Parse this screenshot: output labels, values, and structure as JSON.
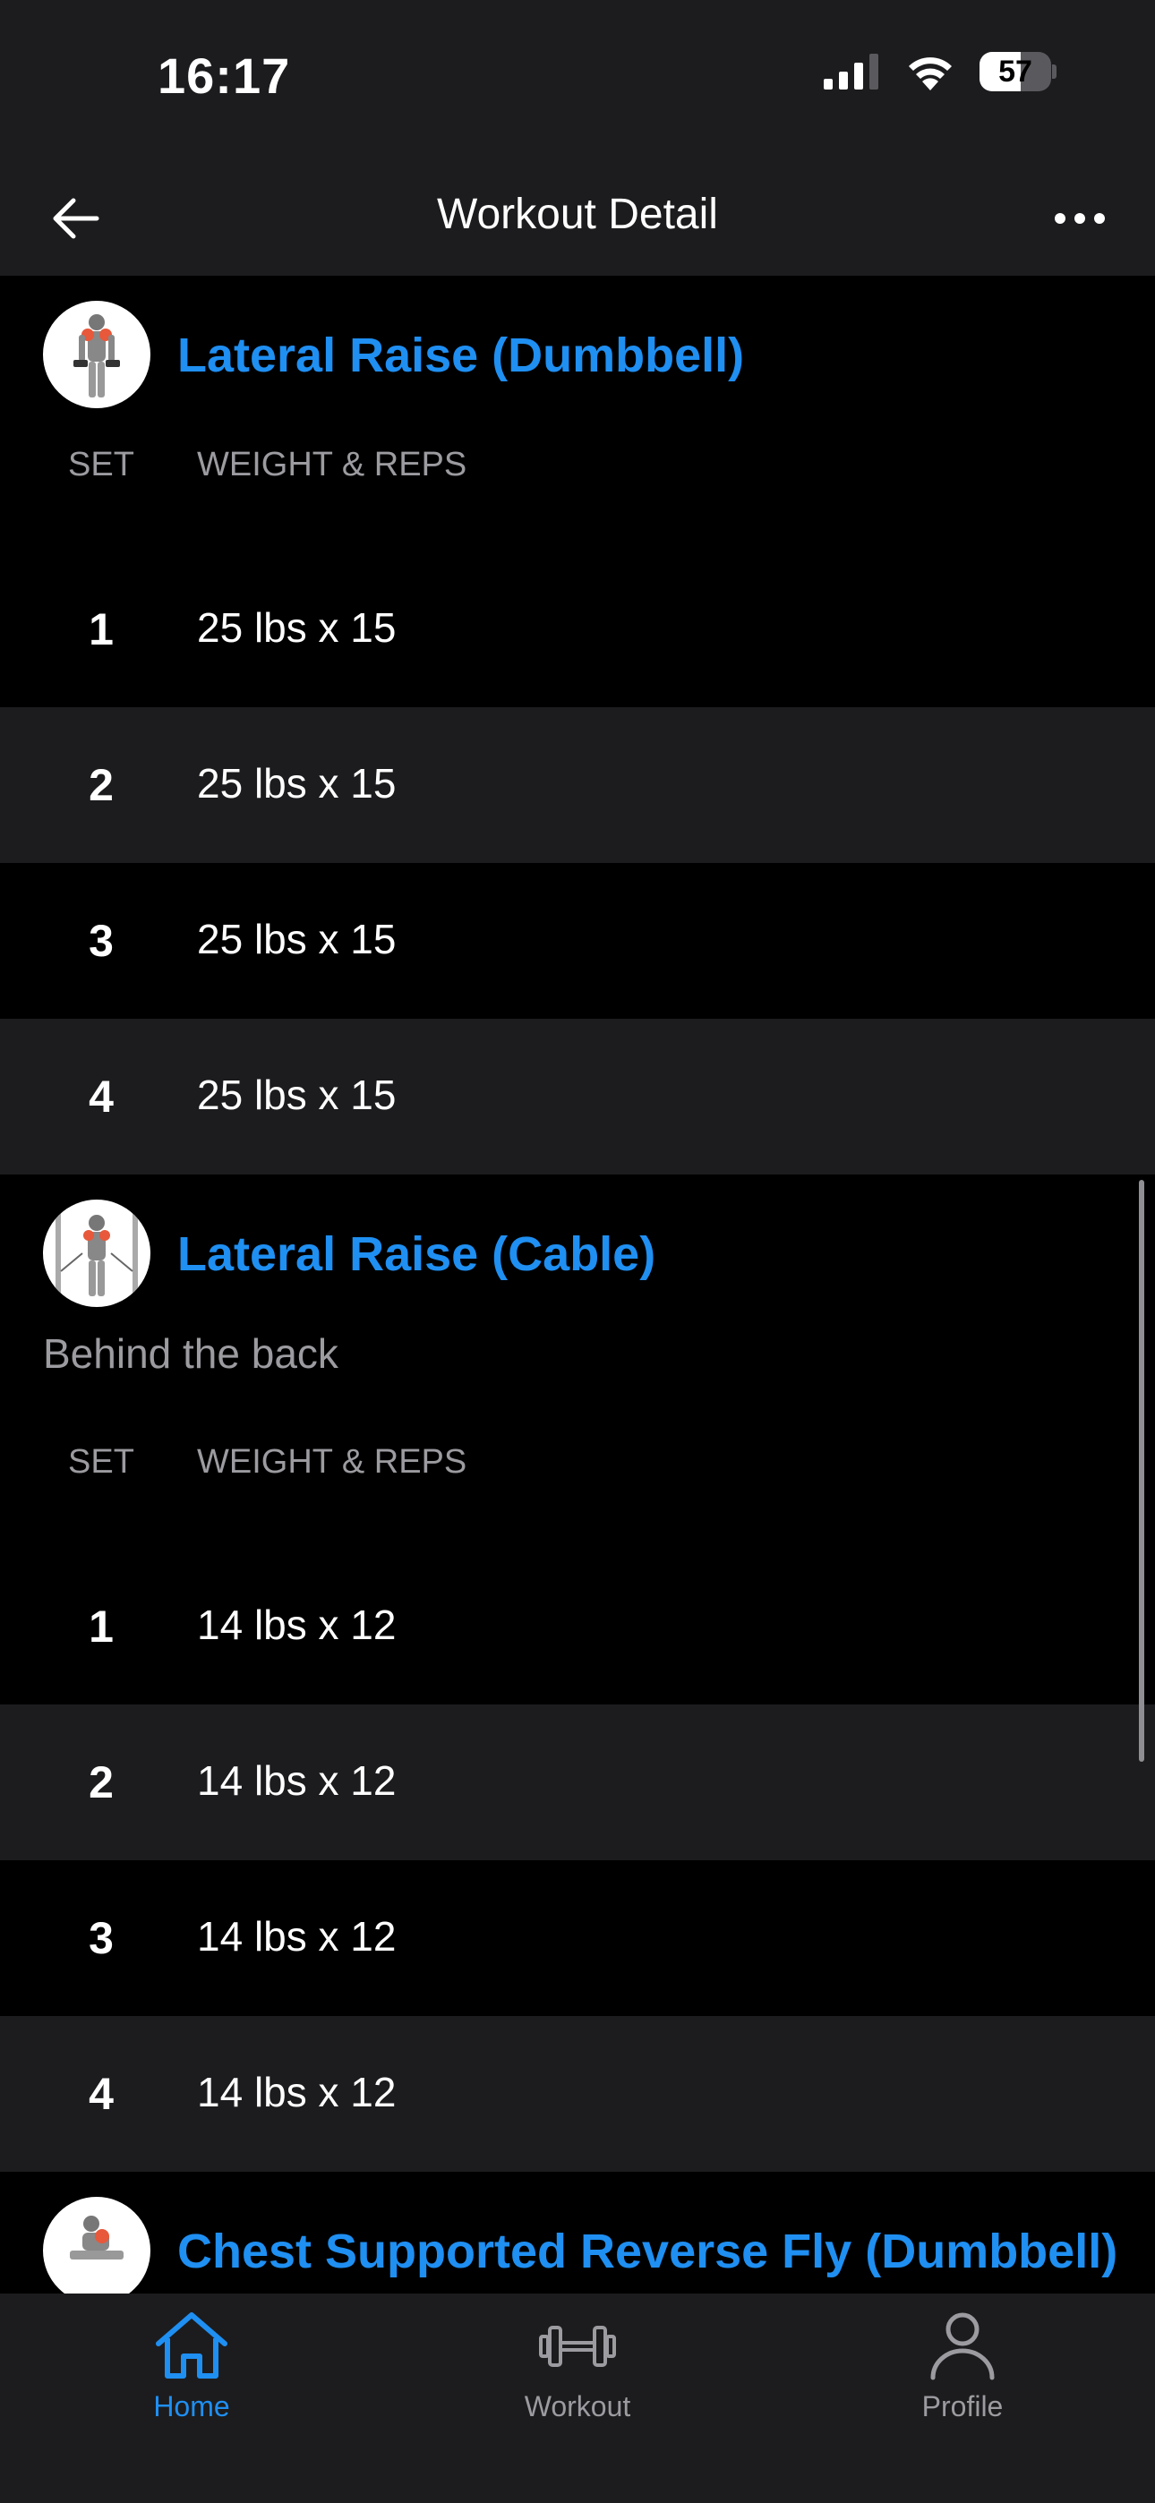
{
  "status": {
    "time": "16:17",
    "battery": "57",
    "battery_level": 0.57
  },
  "nav": {
    "title": "Workout Detail"
  },
  "columns": {
    "set": "SET",
    "weight_reps": "WEIGHT & REPS"
  },
  "exercises": [
    {
      "name": "Lateral Raise (Dumbbell)",
      "sets": [
        {
          "n": "1",
          "value": "25 lbs x 15"
        },
        {
          "n": "2",
          "value": "25 lbs x 15"
        },
        {
          "n": "3",
          "value": "25 lbs x 15"
        },
        {
          "n": "4",
          "value": "25 lbs x 15"
        }
      ]
    },
    {
      "name": "Lateral Raise (Cable)",
      "note": "Behind the back",
      "sets": [
        {
          "n": "1",
          "value": "14 lbs x 12"
        },
        {
          "n": "2",
          "value": "14 lbs x 12"
        },
        {
          "n": "3",
          "value": "14 lbs x 12"
        },
        {
          "n": "4",
          "value": "14 lbs x 12"
        }
      ]
    },
    {
      "name": "Chest Supported Reverse Fly (Dumbbell)"
    }
  ],
  "tabs": [
    {
      "label": "Home",
      "icon": "home-icon",
      "active": true
    },
    {
      "label": "Workout",
      "icon": "dumbbell-icon",
      "active": false
    },
    {
      "label": "Profile",
      "icon": "person-icon",
      "active": false
    }
  ],
  "colors": {
    "accent": "#1f8ff2",
    "bar": "#1c1c1e",
    "alt_row": "#1c1c1e"
  }
}
